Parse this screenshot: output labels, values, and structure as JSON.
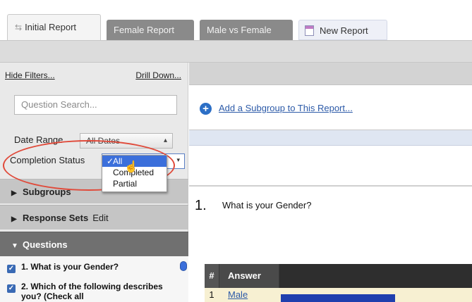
{
  "tabs": [
    {
      "label": "Initial Report"
    },
    {
      "label": "Female Report"
    },
    {
      "label": "Male vs Female"
    },
    {
      "label": "New Report"
    }
  ],
  "sidebar": {
    "hide_filters": "Hide Filters...",
    "drill_down": "Drill Down...",
    "search_placeholder": "Question Search...",
    "date_range_label": "Date Range",
    "date_range_value": "All Dates",
    "completion_label": "Completion Status",
    "completion_options": [
      {
        "label": "All",
        "selected": true
      },
      {
        "label": "Completed",
        "selected": false
      },
      {
        "label": "Partial",
        "selected": false
      }
    ],
    "sections": {
      "subgroups": "Subgroups",
      "response_sets": "Response Sets",
      "response_sets_edit": "Edit",
      "questions": "Questions"
    },
    "questions": [
      {
        "label": "1. What is your Gender?",
        "checked": true
      },
      {
        "label": "2. Which of the following describes you? (Check all",
        "checked": true
      }
    ]
  },
  "main": {
    "add_subgroup": "Add a Subgroup to This Report...",
    "question_number": "1.",
    "question_text": "What is your Gender?",
    "table": {
      "headers": {
        "hash": "#",
        "answer": "Answer"
      },
      "rows": [
        {
          "n": "1",
          "answer": "Male"
        }
      ]
    }
  },
  "colors": {
    "accent_blue": "#2c6fc6",
    "highlight_red": "#e04a3a",
    "selected_blue": "#3b6fdb"
  }
}
